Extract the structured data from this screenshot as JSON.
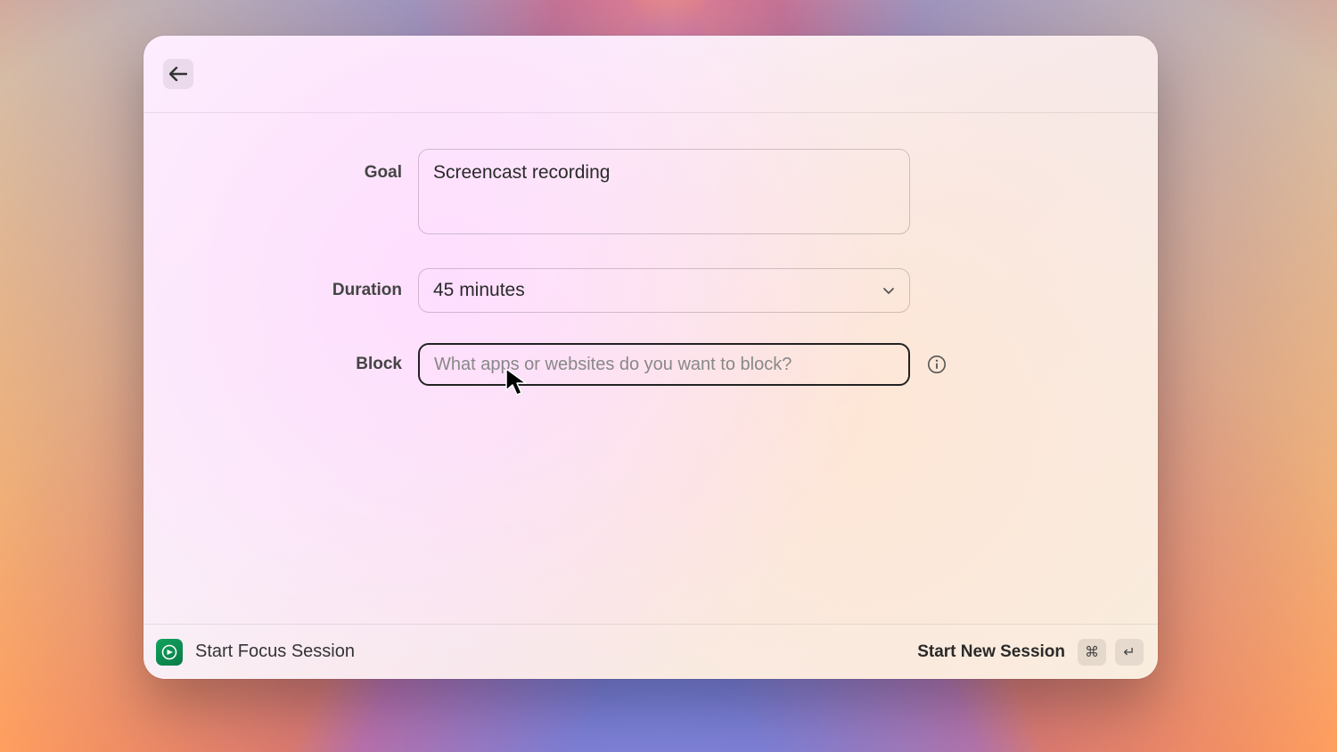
{
  "form": {
    "goal_label": "Goal",
    "goal_value": "Screencast recording",
    "duration_label": "Duration",
    "duration_value": "45 minutes",
    "block_label": "Block",
    "block_placeholder": "What apps or websites do you want to block?",
    "block_value": ""
  },
  "footer": {
    "left_label": "Start Focus Session",
    "right_label": "Start New Session",
    "shortcut_keys": [
      "⌘",
      "↵"
    ]
  }
}
